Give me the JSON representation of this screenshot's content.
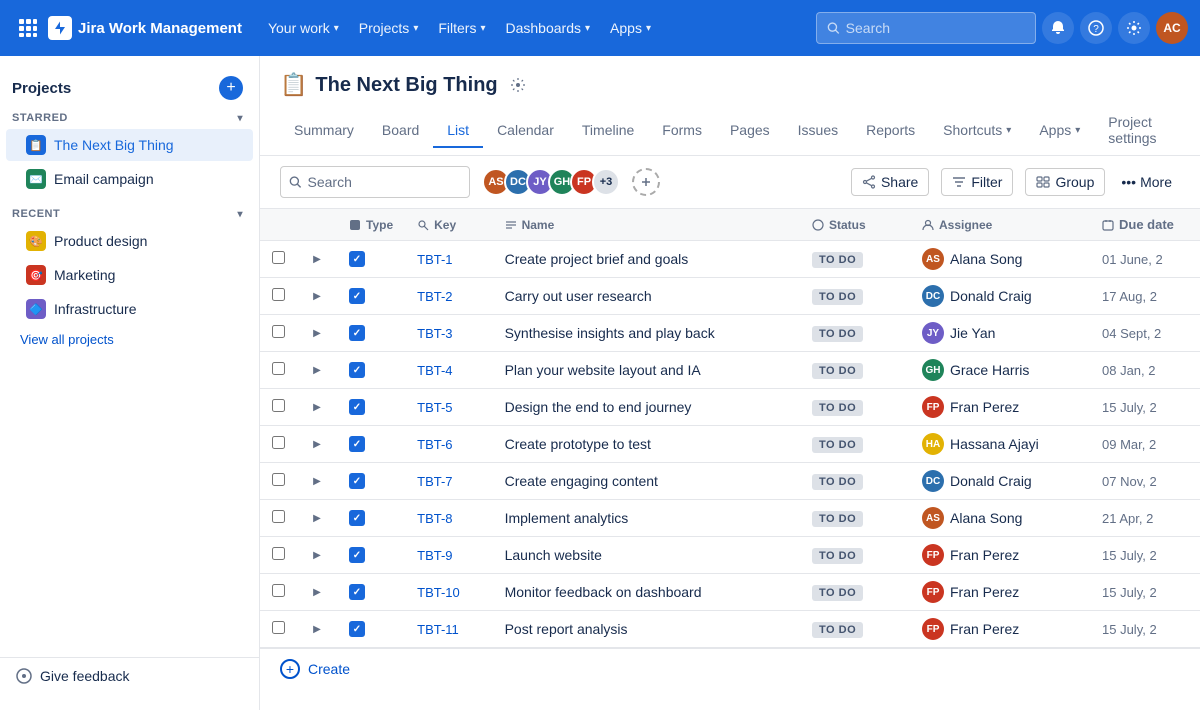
{
  "topNav": {
    "logo_text": "Jira Work Management",
    "items": [
      {
        "label": "Your work",
        "key": "your-work"
      },
      {
        "label": "Projects",
        "key": "projects"
      },
      {
        "label": "Filters",
        "key": "filters"
      },
      {
        "label": "Dashboards",
        "key": "dashboards"
      },
      {
        "label": "Apps",
        "key": "apps"
      }
    ],
    "search_placeholder": "Search",
    "avatar_initials": "AC"
  },
  "sidebar": {
    "projects_label": "Projects",
    "starred_label": "STARRED",
    "recent_label": "RECENT",
    "starred_items": [
      {
        "label": "The Next Big Thing",
        "emoji": "📋",
        "color": "blue"
      },
      {
        "label": "Email campaign",
        "emoji": "✉️",
        "color": "green"
      }
    ],
    "recent_items": [
      {
        "label": "Product design",
        "emoji": "🎨",
        "color": "yellow"
      },
      {
        "label": "Marketing",
        "emoji": "🎯",
        "color": "red"
      },
      {
        "label": "Infrastructure",
        "emoji": "🔷",
        "color": "purple"
      }
    ],
    "view_all": "View all projects",
    "feedback_label": "Give feedback"
  },
  "project": {
    "emoji": "📋",
    "title": "The Next Big Thing",
    "tabs": [
      {
        "label": "Summary",
        "key": "summary"
      },
      {
        "label": "Board",
        "key": "board"
      },
      {
        "label": "List",
        "key": "list",
        "active": true
      },
      {
        "label": "Calendar",
        "key": "calendar"
      },
      {
        "label": "Timeline",
        "key": "timeline"
      },
      {
        "label": "Forms",
        "key": "forms"
      },
      {
        "label": "Pages",
        "key": "pages"
      },
      {
        "label": "Issues",
        "key": "issues"
      },
      {
        "label": "Reports",
        "key": "reports"
      },
      {
        "label": "Shortcuts",
        "key": "shortcuts",
        "hasArrow": true
      },
      {
        "label": "Apps",
        "key": "apps",
        "hasArrow": true
      },
      {
        "label": "Project settings",
        "key": "project-settings"
      }
    ]
  },
  "toolbar": {
    "search_placeholder": "Search",
    "share_label": "Share",
    "filter_label": "Filter",
    "group_label": "Group",
    "more_label": "More",
    "add_person_icon": "+",
    "avatar_count": "+3",
    "avatars": [
      {
        "initials": "AS",
        "color": "#c05621"
      },
      {
        "initials": "DC",
        "color": "#2c6fad"
      },
      {
        "initials": "JY",
        "color": "#6e5dc6"
      },
      {
        "initials": "GH",
        "color": "#1f845a"
      },
      {
        "initials": "FP",
        "color": "#ca3521"
      }
    ]
  },
  "table": {
    "columns": [
      {
        "label": ""
      },
      {
        "label": ""
      },
      {
        "label": "Type",
        "icon": "type-icon"
      },
      {
        "label": "Key",
        "icon": "key-icon"
      },
      {
        "label": "Name",
        "icon": "name-icon"
      },
      {
        "label": "Status",
        "icon": "status-icon"
      },
      {
        "label": "Assignee",
        "icon": "assignee-icon"
      },
      {
        "label": "Due date",
        "icon": "due-icon"
      }
    ],
    "rows": [
      {
        "key": "TBT-1",
        "name": "Create project brief and goals",
        "status": "TO DO",
        "assignee": "Alana Song",
        "assignee_initials": "AS",
        "assignee_color": "#c05621",
        "due": "01 June, 2"
      },
      {
        "key": "TBT-2",
        "name": "Carry out user research",
        "status": "TO DO",
        "assignee": "Donald Craig",
        "assignee_initials": "DC",
        "assignee_color": "#2c6fad",
        "due": "17 Aug, 2"
      },
      {
        "key": "TBT-3",
        "name": "Synthesise insights and play back",
        "status": "TO DO",
        "assignee": "Jie Yan",
        "assignee_initials": "JY",
        "assignee_color": "#6e5dc6",
        "due": "04 Sept, 2"
      },
      {
        "key": "TBT-4",
        "name": "Plan your website layout and IA",
        "status": "TO DO",
        "assignee": "Grace Harris",
        "assignee_initials": "GH",
        "assignee_color": "#1f845a",
        "due": "08 Jan, 2"
      },
      {
        "key": "TBT-5",
        "name": "Design the end to end journey",
        "status": "TO DO",
        "assignee": "Fran Perez",
        "assignee_initials": "FP",
        "assignee_color": "#ca3521",
        "due": "15 July, 2"
      },
      {
        "key": "TBT-6",
        "name": "Create prototype to test",
        "status": "TO DO",
        "assignee": "Hassana Ajayi",
        "assignee_initials": "HA",
        "assignee_color": "#e2b203",
        "due": "09 Mar, 2"
      },
      {
        "key": "TBT-7",
        "name": "Create engaging content",
        "status": "TO DO",
        "assignee": "Donald Craig",
        "assignee_initials": "DC",
        "assignee_color": "#2c6fad",
        "due": "07 Nov, 2"
      },
      {
        "key": "TBT-8",
        "name": "Implement analytics",
        "status": "TO DO",
        "assignee": "Alana Song",
        "assignee_initials": "AS",
        "assignee_color": "#c05621",
        "due": "21 Apr, 2"
      },
      {
        "key": "TBT-9",
        "name": "Launch website",
        "status": "TO DO",
        "assignee": "Fran Perez",
        "assignee_initials": "FP",
        "assignee_color": "#ca3521",
        "due": "15 July, 2"
      },
      {
        "key": "TBT-10",
        "name": "Monitor feedback on dashboard",
        "status": "TO DO",
        "assignee": "Fran Perez",
        "assignee_initials": "FP",
        "assignee_color": "#ca3521",
        "due": "15 July, 2"
      },
      {
        "key": "TBT-11",
        "name": "Post report analysis",
        "status": "TO DO",
        "assignee": "Fran Perez",
        "assignee_initials": "FP",
        "assignee_color": "#ca3521",
        "due": "15 July, 2"
      }
    ],
    "create_label": "Create"
  }
}
